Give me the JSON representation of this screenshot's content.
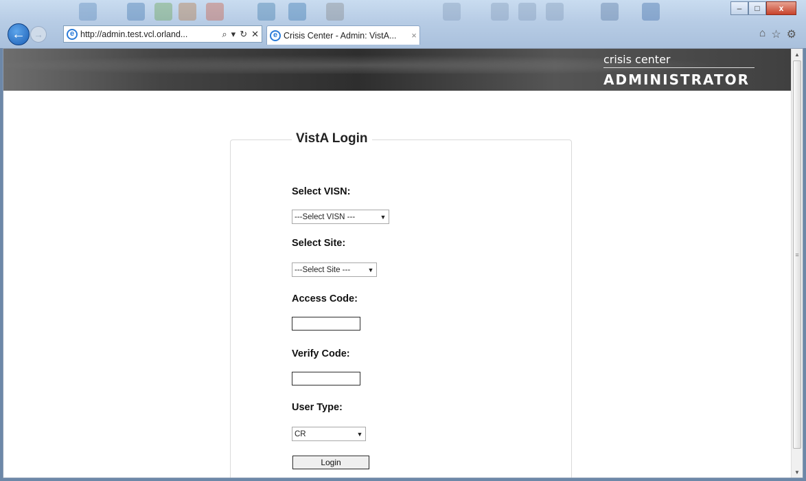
{
  "browser": {
    "address_url": "http://admin.test.vcl.orland...",
    "tab_title": "Crisis Center - Admin: VistA...",
    "tab_close": "×",
    "search_glyph": "⌕",
    "dropdown_glyph": "▾",
    "refresh_glyph": "↻",
    "stop_glyph": "✕",
    "window_minimize": "–",
    "window_maximize": "□",
    "window_close": "x",
    "home_glyph": "⌂",
    "favorites_glyph": "☆",
    "tools_glyph": "⚙",
    "back_glyph": "←",
    "forward_glyph": "→",
    "ie_glyph": "e"
  },
  "banner": {
    "brand_top": "crisis center",
    "brand_main": "ADMINISTRATOR"
  },
  "form": {
    "legend": "VistA Login",
    "visn_label": "Select VISN:",
    "visn_value": "---Select VISN ---",
    "site_label": "Select Site:",
    "site_value": "---Select Site ---",
    "access_label": "Access Code:",
    "verify_label": "Verify Code:",
    "usertype_label": "User Type:",
    "usertype_value": "CR",
    "login_label": "Login",
    "caret": "▼"
  },
  "scrollbar": {
    "up": "▲",
    "down": "▼",
    "grip": "≡"
  },
  "colors": {
    "chrome": "#b7cce5",
    "banner": "#3a3a3a",
    "back_button": "#1c5fb5"
  }
}
